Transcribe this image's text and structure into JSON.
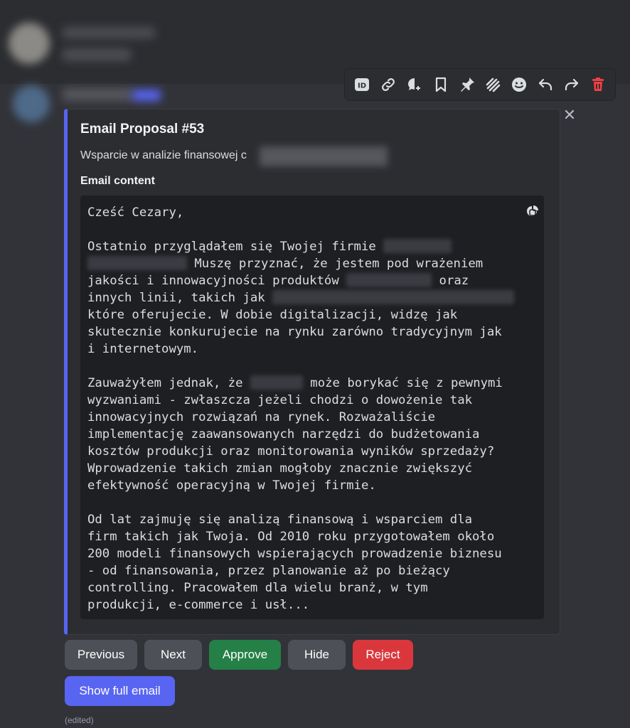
{
  "toolbar": {
    "icons": [
      "id-icon",
      "link-icon",
      "thread-icon",
      "bookmark-icon",
      "pin-icon",
      "caution-icon",
      "emoji-icon",
      "reply-icon",
      "forward-icon",
      "delete-icon"
    ]
  },
  "embed": {
    "title": "Email Proposal #53",
    "description": "Wsparcie w analizie finansowej c",
    "field_name": "Email content",
    "code": {
      "l1": "Cześć Cezary,",
      "l3a": "Ostatnio przyglądałem się Twojej firmie",
      "l4b": " Muszę przyznać, że jestem pod wrażeniem",
      "l5a": "jakości i innowacyjności produktów",
      "l5c": " oraz",
      "l6a": "innych linii, takich jak",
      "l7": "które oferujecie. W dobie digitalizacji, widzę jak",
      "l8": "skutecznie konkurujecie na rynku zarówno tradycyjnym jak",
      "l9": "i internetowym.",
      "l11a": "Zauważyłem jednak, że",
      "l11c": " może borykać się z pewnymi",
      "l12": "wyzwaniami - zwłaszcza jeżeli chodzi o dowożenie tak",
      "l13": "innowacyjnych rozwiązań na rynek. Rozważaliście",
      "l14": "implementację zaawansowanych narzędzi do budżetowania",
      "l15": "kosztów produkcji oraz monitorowania wyników sprzedaży?",
      "l16": "Wprowadzenie takich zmian mogłoby znacznie zwiększyć",
      "l17": "efektywność operacyjną w Twojej firmie.",
      "l19": "Od lat zajmuję się analizą finansową i wsparciem dla",
      "l20": "firm takich jak Twoja. Od 2010 roku przygotowałem około",
      "l21": "200 modeli finansowych wspierających prowadzenie biznesu",
      "l22": "- od finansowania, przez planowanie aż po bieżący",
      "l23": "controlling. Pracowałem dla wielu branż, w tym",
      "l24": "produkcji, e-commerce i usł..."
    }
  },
  "buttons": {
    "previous": "Previous",
    "next": "Next",
    "approve": "Approve",
    "hide": "Hide",
    "reject": "Reject",
    "show_full": "Show full email"
  },
  "edited": "(edited)",
  "colors": {
    "accent": "#5865f2",
    "approve": "#248046",
    "reject": "#da373c",
    "secondary": "#4e5058"
  }
}
